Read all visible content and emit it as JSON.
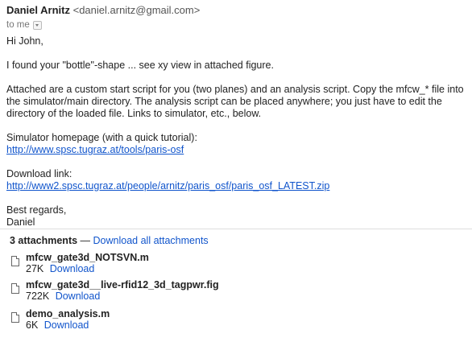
{
  "email": {
    "sender_name": "Daniel Arnitz",
    "sender_email": "<daniel.arnitz@gmail.com>",
    "to_label": "to me",
    "greeting": "Hi John,",
    "paragraph1": "I found your \"bottle\"-shape ... see xy view in attached figure.",
    "paragraph2": "Attached are a custom start script for you (two planes) and an analysis script. Copy the mfcw_* file into the simulator/main directory. The analysis script can be placed anywhere; you just have to edit the directory of the loaded file. Links to simulator, etc., below.",
    "simulator_label": "Simulator homepage (with a quick tutorial):",
    "simulator_link": "http://www.spsc.tugraz.at/tools/paris-osf",
    "download_label": "Download link:",
    "download_link": "http://www2.spsc.tugraz.at/people/arnitz/paris_osf/paris_osf_LATEST.zip",
    "closing": "Best regards,",
    "signature": "Daniel"
  },
  "attachments": {
    "count_label": "3 attachments",
    "separator": "—",
    "download_all": "Download all attachments",
    "items": [
      {
        "name": "mfcw_gate3d_NOTSVN.m",
        "size": "27K",
        "action": "Download"
      },
      {
        "name": "mfcw_gate3d__live-rfid12_3d_tagpwr.fig",
        "size": "722K",
        "action": "Download"
      },
      {
        "name": "demo_analysis.m",
        "size": "6K",
        "action": "Download"
      }
    ]
  },
  "colors": {
    "link": "#1155cc",
    "text": "#222222",
    "meta": "#777777"
  },
  "icons": {
    "recipient_menu": "chevron-down-icon",
    "attachment_file": "file-icon"
  }
}
